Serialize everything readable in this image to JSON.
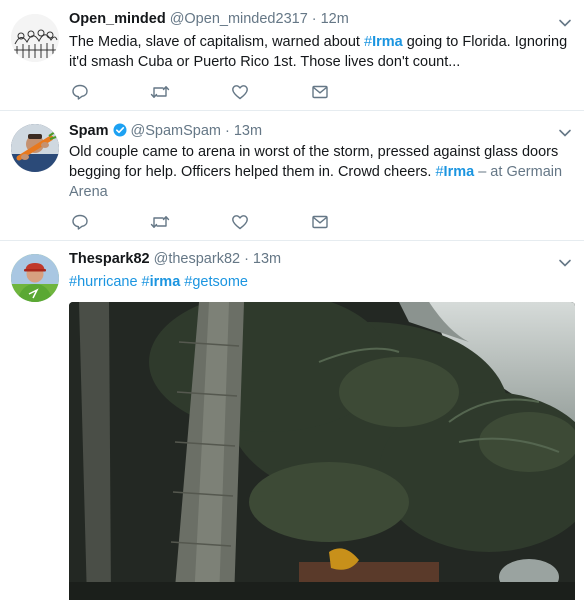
{
  "tweets": [
    {
      "name": "Open_minded",
      "handle": "@Open_minded2317",
      "dot": "·",
      "time": "12m",
      "text_a": "The Media, slave of capitalism, warned about ",
      "tag1_hash": "#",
      "tag1_word": "Irma",
      "text_b": " going to Florida. Ignoring it'd smash Cuba or Puerto Rico 1st. Those lives don't count...",
      "avatar_icon": "sketch-crowd-avatar",
      "verified": false
    },
    {
      "name": "Spam",
      "handle": "@SpamSpam",
      "dot": "·",
      "time": "13m",
      "text_a": "Old couple came to arena in worst of the storm, pressed against glass doors begging for help. Officers helped them in. Crowd cheers. ",
      "tag1_hash": "#",
      "tag1_word": "Irma",
      "text_b": " – at ",
      "location": "Germain Arena",
      "avatar_icon": "man-holding-carrot-avatar",
      "verified": true
    },
    {
      "name": "Thespark82",
      "handle": "@thespark82",
      "dot": "·",
      "time": "13m",
      "hashtags": [
        "#hurricane",
        "#",
        "irma",
        "#getsome"
      ],
      "avatar_icon": "man-in-cap-avatar",
      "media_icon": "hurricane-trees-video-frame",
      "verified": false
    }
  ],
  "actions": [
    "reply-icon",
    "retweet-icon",
    "like-icon",
    "direct-message-icon"
  ],
  "colors": {
    "link": "#1b95e0",
    "text": "#14171a",
    "muted": "#657786",
    "icon": "#657786",
    "verified": "#1da1f2",
    "divider": "#e6ecf0"
  }
}
